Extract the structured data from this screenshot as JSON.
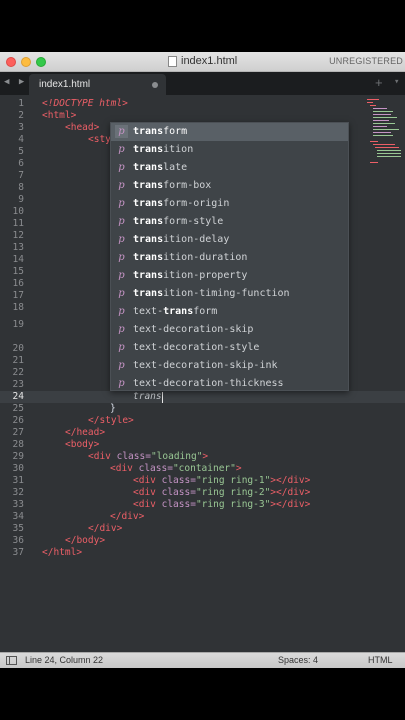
{
  "window": {
    "title": "index1.html",
    "license_status": "UNREGISTERED"
  },
  "tabs": {
    "nav_arrows": "◀ ▶",
    "active_tab": "index1.html",
    "new_tab": "+",
    "tab_menu": "▾"
  },
  "editor": {
    "line_numbers": [
      "1",
      "2",
      "3",
      "4",
      "5",
      "6",
      "7",
      "8",
      "9",
      "10",
      "11",
      "12",
      "13",
      "14",
      "15",
      "16",
      "17",
      "18",
      "19",
      "20",
      "21",
      "22",
      "23",
      "24",
      "25",
      "26",
      "27",
      "28",
      "29",
      "30",
      "31",
      "32",
      "33",
      "34",
      "35",
      "36",
      "37"
    ],
    "active_line": "24",
    "lines": {
      "l1": "<!DOCTYPE html>",
      "l2": "<html>",
      "l3": "<head>",
      "l4": "<sty",
      "l24": "trans",
      "l25": "}",
      "l26": "</style>",
      "l27": "</head>",
      "l28": "<body>",
      "l29_tag": "<div ",
      "l29_attr": "class=",
      "l29_str": "\"loading\"",
      "l29_end": ">",
      "l30_tag": "<div ",
      "l30_attr": "class=",
      "l30_str": "\"container\"",
      "l30_end": ">",
      "l31_tag": "<div ",
      "l31_attr": "class=",
      "l31_str": "\"ring ring-1\"",
      "l31_end": "></div>",
      "l32_tag": "<div ",
      "l32_attr": "class=",
      "l32_str": "\"ring ring-2\"",
      "l32_end": "></div>",
      "l33_tag": "<div ",
      "l33_attr": "class=",
      "l33_str": "\"ring ring-3\"",
      "l33_end": "></div>",
      "l34": "</div>",
      "l35": "</div>",
      "l36": "</body>",
      "l37": "</html>"
    }
  },
  "autocomplete": {
    "kind_glyph": "p",
    "items": [
      {
        "match": "trans",
        "rest": "form"
      },
      {
        "match": "trans",
        "rest": "ition"
      },
      {
        "match": "trans",
        "rest": "late"
      },
      {
        "match": "trans",
        "rest": "form-box"
      },
      {
        "match": "trans",
        "rest": "form-origin"
      },
      {
        "match": "trans",
        "rest": "form-style"
      },
      {
        "match": "trans",
        "rest": "ition-delay"
      },
      {
        "match": "trans",
        "rest": "ition-duration"
      },
      {
        "match": "trans",
        "rest": "ition-property"
      },
      {
        "match": "trans",
        "rest": "ition-timing-function"
      },
      {
        "pre": "text-",
        "match": "trans",
        "rest": "form"
      },
      {
        "pre": "text-",
        "match": "",
        "rest": "decoration-skip"
      },
      {
        "pre": "text-",
        "match": "",
        "rest": "decoration-style"
      },
      {
        "pre": "text-",
        "match": "",
        "rest": "decoration-skip-ink"
      },
      {
        "pre": "text-",
        "match": "",
        "rest": "decoration-thickness"
      }
    ]
  },
  "statusbar": {
    "position": "Line 24, Column 22",
    "indentation": "Spaces: 4",
    "syntax": "HTML"
  },
  "colors": {
    "editor_bg": "#303336",
    "tag": "#ec5f67",
    "attribute": "#c594c5",
    "string": "#99c794"
  }
}
